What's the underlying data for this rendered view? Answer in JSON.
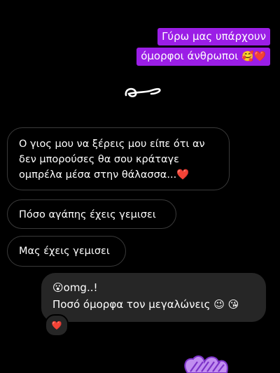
{
  "caption": {
    "line1": "Γύρω μας υπάρχουν",
    "line2": "όμορφοι άνθρωποι",
    "line2_emoji": "🥰❤️"
  },
  "messages_received": [
    {
      "lines": [
        "Ο γιος μου να ξέρεις μου είπε ότι αν",
        "δεν μπορούσες θα σου κράταγε",
        "ομπρέλα μέσα στην θάλασσα..."
      ],
      "emoji": "❤️"
    },
    {
      "text": "Πόσο αγάπης έχεις γεμισει"
    },
    {
      "text": "Μας έχεις γεμισει"
    }
  ],
  "message_sent": {
    "lead_emoji": "😮",
    "line1": "omg..!",
    "line2": "Ποσό όμορφα τον μεγαλώνεις",
    "trail_emoji": "😉 😘"
  },
  "reaction": {
    "emoji": "❤️"
  },
  "colors": {
    "caption_highlight": "#9b1ee6",
    "sent_bubble": "#262626",
    "received_border": "#3a3a3a",
    "heart": "#e3202c"
  }
}
